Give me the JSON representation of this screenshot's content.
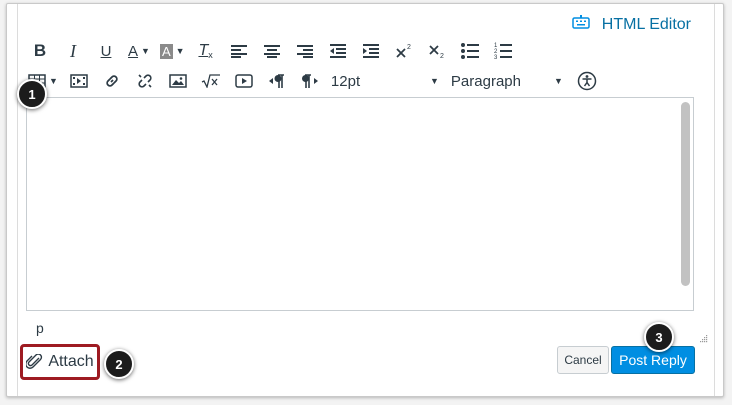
{
  "header": {
    "html_editor_label": "HTML Editor",
    "keyboard_icon": "keyboard-icon"
  },
  "toolbar": {
    "row1": [
      "bold",
      "italic",
      "underline",
      "text-color",
      "background-color",
      "clear-formatting",
      "align-left",
      "align-center",
      "align-right",
      "outdent",
      "indent",
      "superscript",
      "subscript",
      "bulleted-list",
      "numbered-list"
    ],
    "row2": [
      "table",
      "media",
      "link",
      "unlink",
      "image",
      "equation",
      "embed-video",
      "ltr",
      "rtl",
      "font-size",
      "block-format",
      "accessibility"
    ],
    "bold": "B",
    "italic": "I",
    "underline": "U",
    "text_color": "A",
    "background_color": "A",
    "clear_formatting": "T",
    "font_size": "12pt",
    "block_format": "Paragraph"
  },
  "editor": {
    "status_path": "p"
  },
  "footer": {
    "attach_label": "Attach",
    "cancel_label": "Cancel",
    "post_reply_label": "Post Reply"
  },
  "callouts": [
    "1",
    "2",
    "3"
  ],
  "colors": {
    "accent": "#008ee2",
    "link": "#0770a3",
    "highlight_border": "#9e1b22",
    "callout_bg": "#1c1c1c"
  }
}
